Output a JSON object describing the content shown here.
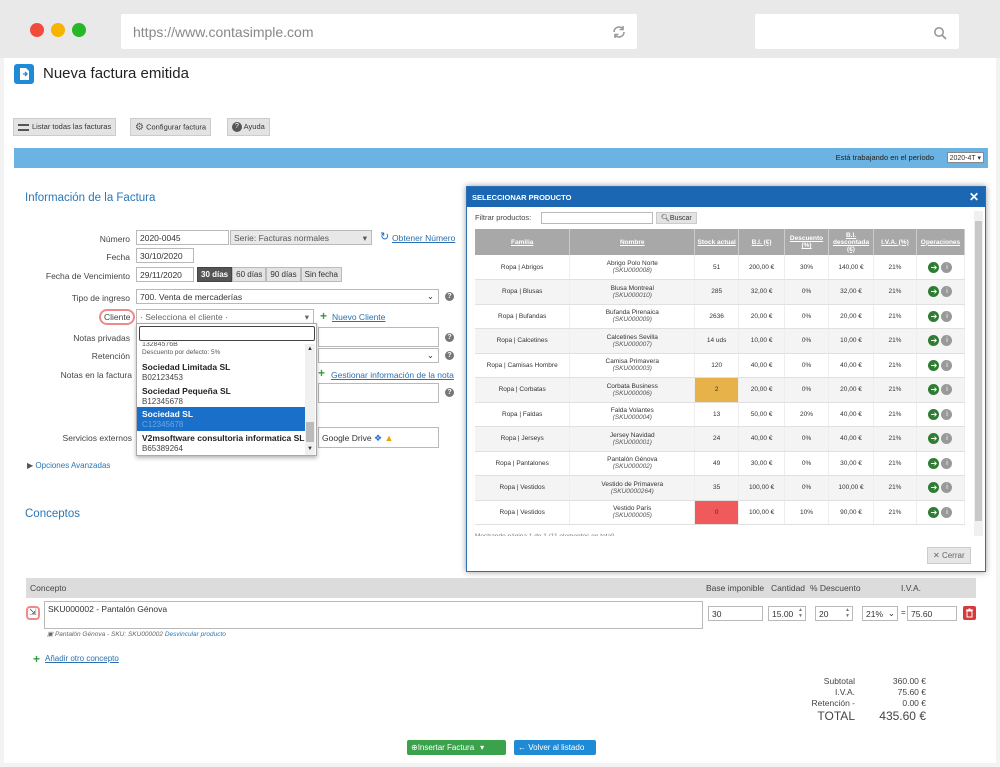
{
  "browser": {
    "url": "https://www.contasimple.com"
  },
  "page": {
    "title": "Nueva factura emitida"
  },
  "toolbar": {
    "list_label": "Listar todas las facturas",
    "config_label": "Configurar factura",
    "help_label": "Ayuda"
  },
  "banner": {
    "period_text": "Está trabajando en el período",
    "period_value": "2020-4T"
  },
  "invoice": {
    "section_title": "Información de la Factura",
    "numero_label": "Número",
    "numero_value": "2020-0045",
    "serie_value": "Serie: Facturas normales",
    "obtener_link": "Obtener Número",
    "fecha_label": "Fecha",
    "fecha_value": "30/10/2020",
    "venc_label": "Fecha de Vencimiento",
    "venc_value": "29/11/2020",
    "venc_opts": [
      "30 días",
      "60 días",
      "90 días",
      "Sin fecha"
    ],
    "tipo_label": "Tipo de ingreso",
    "tipo_value": "700. Venta de mercaderías",
    "cliente_label": "Cliente",
    "cliente_value": "· Selecciona el cliente ·",
    "nuevo_cliente": "Nuevo Cliente",
    "notas_priv_label": "Notas privadas",
    "retencion_label": "Retención",
    "notas_fact_label": "Notas en la factura",
    "gestionar_link": "Gestionar información de la nota",
    "servicios_label": "Servicios externos",
    "gdrive_label": "Google Drive",
    "opciones_label": "Opciones Avanzadas"
  },
  "dropdown": {
    "partial_top": "13284576B",
    "desc_text": "Descuento por defecto: 5%",
    "items": [
      {
        "name": "Sociedad Limitada SL",
        "id": "B02123453"
      },
      {
        "name": "Sociedad Pequeña SL",
        "id": "B12345678"
      },
      {
        "name": "Sociedad SL",
        "id": "C12345678"
      },
      {
        "name": "V2msoftware consultoria informatica SL",
        "id": "B65389264"
      }
    ]
  },
  "modal": {
    "title": "SELECCIONAR PRODUCTO",
    "filter_label": "Filtrar productos:",
    "search_btn": "Buscar",
    "columns": [
      "Familia",
      "Nombre",
      "Stock actual",
      "B.I. (€)",
      "Descuento (%)",
      "B.I. descontada (€)",
      "I.V.A. (%)",
      "Operaciones"
    ],
    "rows": [
      {
        "familia": "Ropa | Abrigos",
        "nombre": "Abrigo Polo Norte",
        "sku": "(SKU000008)",
        "stock": "51",
        "bi": "200,00 €",
        "desc": "30%",
        "bid": "140,00 €",
        "iva": "21%",
        "stock_color": ""
      },
      {
        "familia": "Ropa | Blusas",
        "nombre": "Blusa Montreal",
        "sku": "(SKU000010)",
        "stock": "285",
        "bi": "32,00 €",
        "desc": "0%",
        "bid": "32,00 €",
        "iva": "21%",
        "stock_color": ""
      },
      {
        "familia": "Ropa | Bufandas",
        "nombre": "Bufanda Pirenaica",
        "sku": "(SKU000009)",
        "stock": "2636",
        "bi": "20,00 €",
        "desc": "0%",
        "bid": "20,00 €",
        "iva": "21%",
        "stock_color": ""
      },
      {
        "familia": "Ropa | Calcetines",
        "nombre": "Calcetines Sevilla",
        "sku": "(SKU000007)",
        "stock": "14 uds",
        "bi": "10,00 €",
        "desc": "0%",
        "bid": "10,00 €",
        "iva": "21%",
        "stock_color": ""
      },
      {
        "familia": "Ropa | Camisas Hombre",
        "nombre": "Camisa Primavera",
        "sku": "(SKU000003)",
        "stock": "120",
        "bi": "40,00 €",
        "desc": "0%",
        "bid": "40,00 €",
        "iva": "21%",
        "stock_color": ""
      },
      {
        "familia": "Ropa | Corbatas",
        "nombre": "Corbata Business",
        "sku": "(SKU000006)",
        "stock": "2",
        "bi": "20,00 €",
        "desc": "0%",
        "bid": "20,00 €",
        "iva": "21%",
        "stock_color": "#e8b24a"
      },
      {
        "familia": "Ropa | Faldas",
        "nombre": "Falda Volantes",
        "sku": "(SKU000004)",
        "stock": "13",
        "bi": "50,00 €",
        "desc": "20%",
        "bid": "40,00 €",
        "iva": "21%",
        "stock_color": ""
      },
      {
        "familia": "Ropa | Jerseys",
        "nombre": "Jersey Navidad",
        "sku": "(SKU000001)",
        "stock": "24",
        "bi": "40,00 €",
        "desc": "0%",
        "bid": "40,00 €",
        "iva": "21%",
        "stock_color": ""
      },
      {
        "familia": "Ropa | Pantalones",
        "nombre": "Pantalón Génova",
        "sku": "(SKU000002)",
        "stock": "49",
        "bi": "30,00 €",
        "desc": "0%",
        "bid": "30,00 €",
        "iva": "21%",
        "stock_color": ""
      },
      {
        "familia": "Ropa | Vestidos",
        "nombre": "Vestido de Primavera",
        "sku": "(SKU0000264)",
        "stock": "35",
        "bi": "100,00 €",
        "desc": "0%",
        "bid": "100,00 €",
        "iva": "21%",
        "stock_color": ""
      },
      {
        "familia": "Ropa | Vestidos",
        "nombre": "Vestido París",
        "sku": "(SKU000005)",
        "stock": "0",
        "bi": "100,00 €",
        "desc": "10%",
        "bid": "90,00 €",
        "iva": "21%",
        "stock_color": "#f05a5a"
      }
    ],
    "footer_text": "Mostrando página 1 de 1 (11 elementos en total)",
    "close_btn": "Cerrar"
  },
  "conceptos": {
    "section_title": "Conceptos",
    "headers": {
      "concepto": "Concepto",
      "base": "Base imponible",
      "cantidad": "Cantidad",
      "descuento": "% Descuento",
      "iva": "I.V.A."
    },
    "line": {
      "text": "SKU000002 - Pantalón Génova",
      "base": "30",
      "cantidad": "15.00",
      "descuento": "20",
      "iva": "21%",
      "total": "75.60"
    },
    "sub_note": "Pantalón Génova - SKU: SKU000002",
    "desvincular": "Desvincular producto",
    "add_link": "Añadir otro concepto"
  },
  "totals": {
    "subtotal_label": "Subtotal",
    "subtotal_value": "360.00 €",
    "iva_label": "I.V.A.",
    "iva_value": "75.60 €",
    "ret_label": "Retención -",
    "ret_value": "0.00 €",
    "total_label": "TOTAL",
    "total_value": "435.60 €"
  },
  "actions": {
    "insert": "Insertar Factura",
    "back": "Volver al listado"
  }
}
